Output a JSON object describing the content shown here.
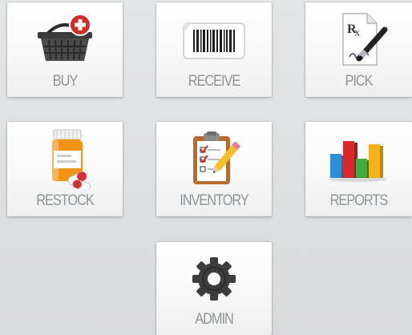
{
  "menu": {
    "tiles": [
      {
        "label": "BUY",
        "icon": "shopping-basket-add-icon"
      },
      {
        "label": "RECEIVE",
        "icon": "barcode-icon"
      },
      {
        "label": "PICK",
        "icon": "prescription-pen-icon"
      },
      {
        "label": "RESTOCK",
        "icon": "pill-bottle-icon"
      },
      {
        "label": "INVENTORY",
        "icon": "clipboard-checklist-icon"
      },
      {
        "label": "REPORTS",
        "icon": "bar-chart-icon"
      },
      {
        "label": "ADMIN",
        "icon": "gear-icon"
      }
    ]
  },
  "colors": {
    "background": "#dfe0e2",
    "tile": "#f8f8f8",
    "label": "#8f9295",
    "add_badge": "#d42a2a"
  }
}
